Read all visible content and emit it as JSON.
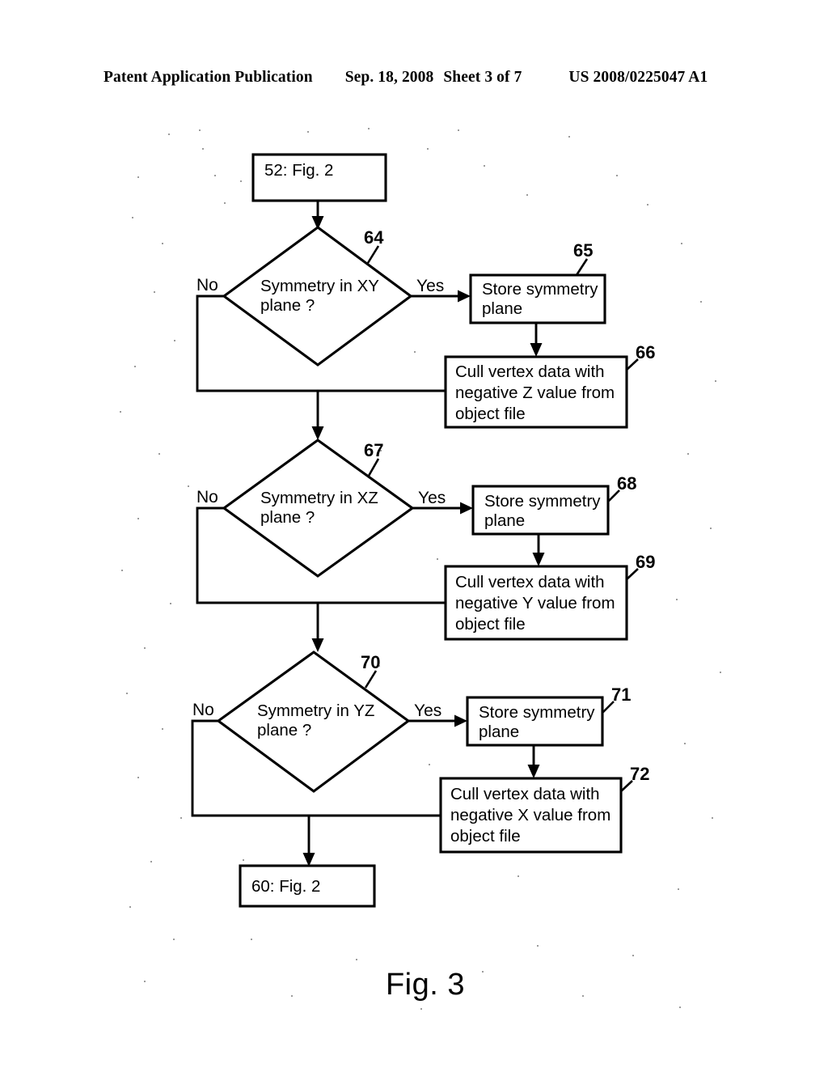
{
  "header": {
    "publication": "Patent Application Publication",
    "date": "Sep. 18, 2008",
    "sheet": "Sheet 3 of 7",
    "pub_number": "US 2008/0225047 A1"
  },
  "figure": {
    "caption": "Fig. 3",
    "nodes": {
      "start": {
        "label": "52: Fig. 2",
        "ref": "52"
      },
      "decision1": {
        "label_line1": "Symmetry in XY",
        "label_line2": "plane ?",
        "ref": "64"
      },
      "store1": {
        "label_line1": "Store symmetry",
        "label_line2": "plane",
        "ref": "65"
      },
      "cull1": {
        "label_line1": "Cull vertex data with",
        "label_line2": "negative Z value from",
        "label_line3": "object file",
        "ref": "66"
      },
      "decision2": {
        "label_line1": "Symmetry in XZ",
        "label_line2": "plane ?",
        "ref": "67"
      },
      "store2": {
        "label_line1": "Store symmetry",
        "label_line2": "plane",
        "ref": "68"
      },
      "cull2": {
        "label_line1": "Cull vertex data with",
        "label_line2": "negative Y value from",
        "label_line3": "object file",
        "ref": "69"
      },
      "decision3": {
        "label_line1": "Symmetry in YZ",
        "label_line2": "plane ?",
        "ref": "70"
      },
      "store3": {
        "label_line1": "Store symmetry",
        "label_line2": "plane",
        "ref": "71"
      },
      "cull3": {
        "label_line1": "Cull vertex data with",
        "label_line2": "negative X value from",
        "label_line3": "object file",
        "ref": "72"
      },
      "end": {
        "label": "60: Fig. 2",
        "ref": "60"
      }
    },
    "branch_labels": {
      "no1": "No",
      "yes1": "Yes",
      "no2": "No",
      "yes2": "Yes",
      "no3": "No",
      "yes3": "Yes"
    }
  },
  "colors": {
    "ink": "#000000",
    "paper": "#ffffff"
  }
}
